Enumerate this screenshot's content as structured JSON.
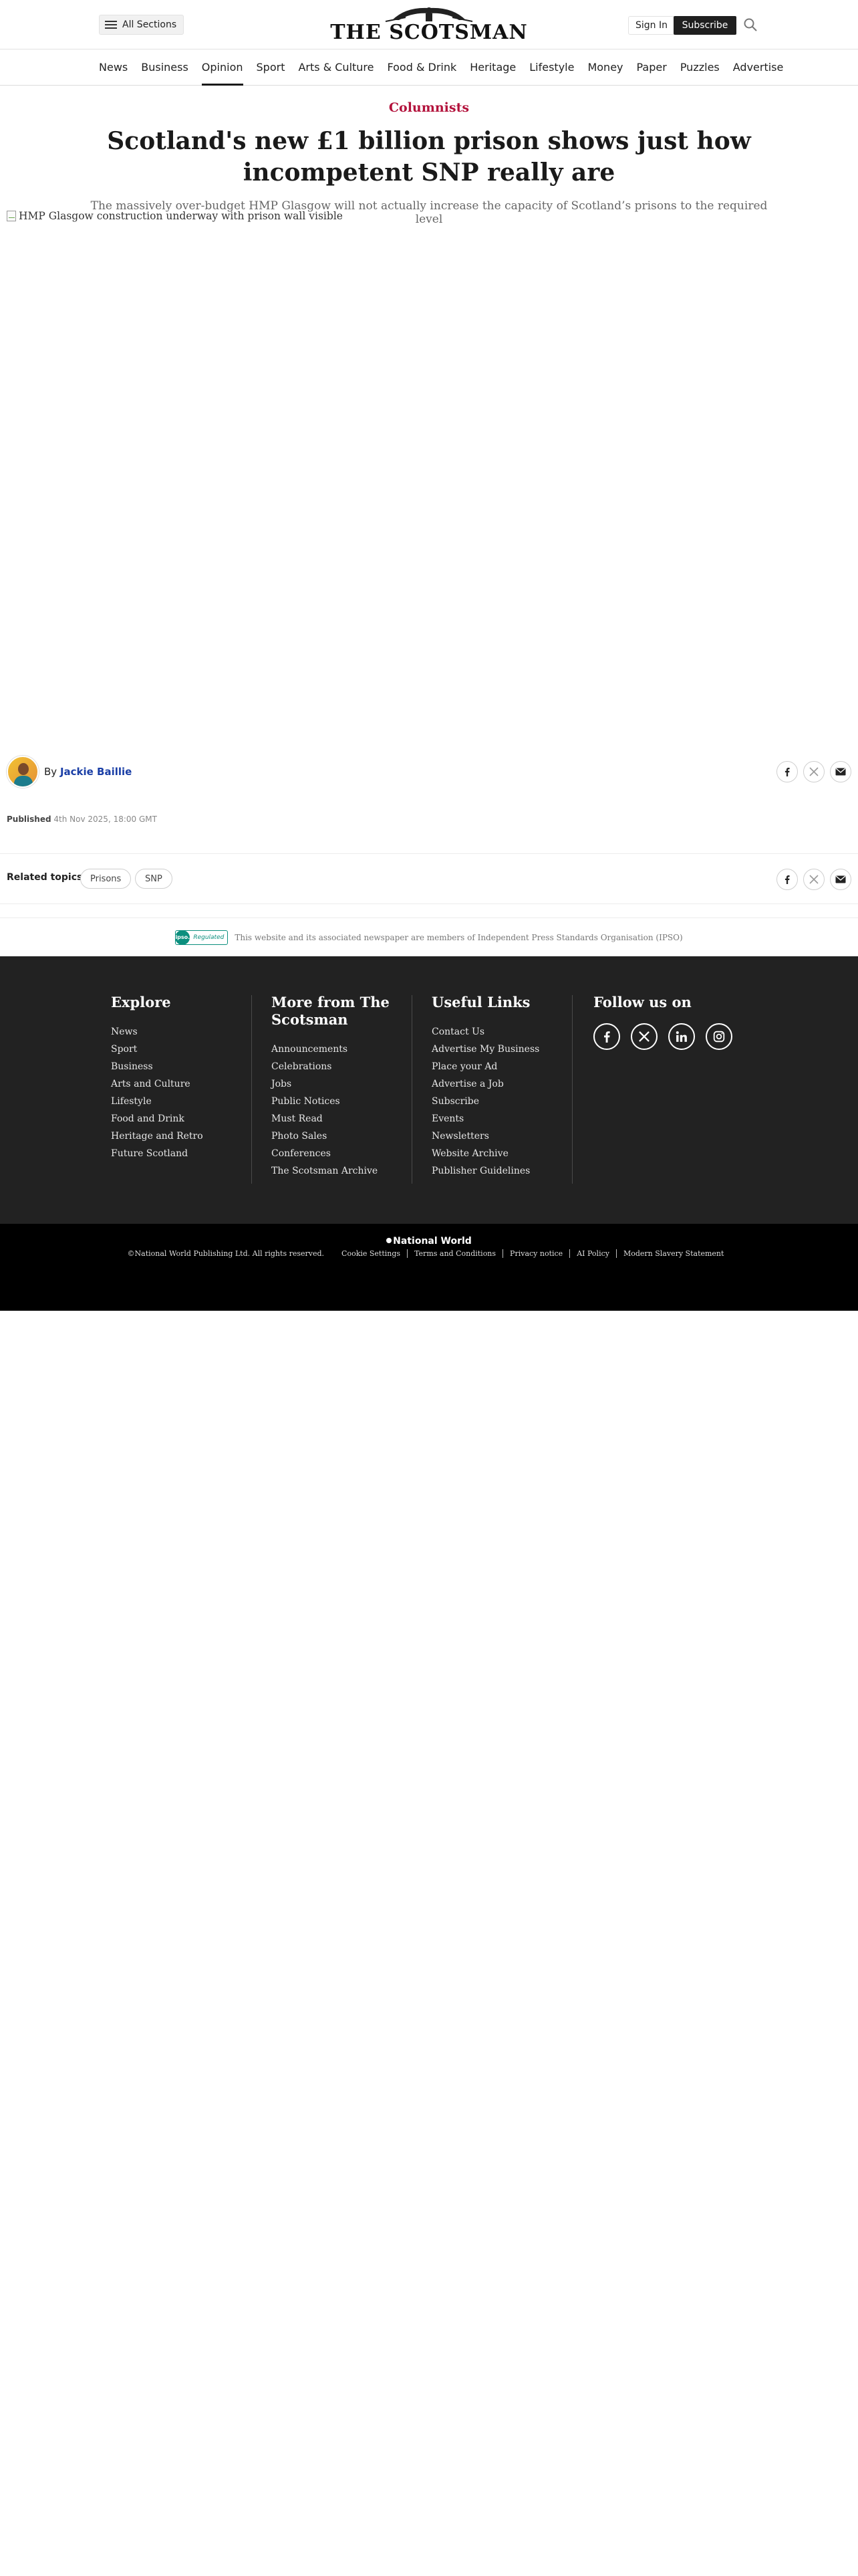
{
  "header": {
    "all_sections_label": "All Sections",
    "site_name": "THE SCOTSMAN",
    "signin_label": "Sign In",
    "subscribe_label": "Subscribe"
  },
  "nav": {
    "items": [
      {
        "label": "News"
      },
      {
        "label": "Business"
      },
      {
        "label": "Opinion",
        "active": true
      },
      {
        "label": "Sport"
      },
      {
        "label": "Arts & Culture"
      },
      {
        "label": "Food & Drink"
      },
      {
        "label": "Heritage"
      },
      {
        "label": "Lifestyle"
      },
      {
        "label": "Money"
      },
      {
        "label": "Paper"
      },
      {
        "label": "Puzzles"
      },
      {
        "label": "Advertise"
      }
    ]
  },
  "article": {
    "category": "Columnists",
    "headline": "Scotland's new £1 billion prison shows just how incompetent SNP really are",
    "standfirst": "The massively over-budget HMP Glasgow will not actually increase the capacity of Scotland’s prisons to the required level",
    "image_alt": "HMP Glasgow construction underway with prison wall visible",
    "byline_prefix": "By",
    "author": "Jackie Baillie",
    "published_label": "Published",
    "published_date": "4th Nov 2025, 18:00 GMT",
    "related_label": "Related topics:",
    "topics": [
      "Prisons",
      "SNP"
    ]
  },
  "ipso": {
    "badge_short": "ipso.",
    "badge_word": "Regulated",
    "text": "This website and its associated newspaper are members of Independent Press Standards Organisation (IPSO)"
  },
  "footer": {
    "explore": {
      "title": "Explore",
      "links": [
        "News",
        "Sport",
        "Business",
        "Arts and Culture",
        "Lifestyle",
        "Food and Drink",
        "Heritage and Retro",
        "Future Scotland"
      ]
    },
    "more": {
      "title": "More from The Scotsman",
      "links": [
        "Announcements",
        "Celebrations",
        "Jobs",
        "Public Notices",
        "Must Read",
        "Photo Sales",
        "Conferences",
        "The Scotsman Archive"
      ]
    },
    "useful": {
      "title": "Useful Links",
      "links": [
        "Contact Us",
        "Advertise My Business",
        "Place your Ad",
        "Advertise a Job",
        "Subscribe",
        "Events",
        "Newsletters",
        "Website Archive",
        "Publisher Guidelines"
      ]
    },
    "follow": {
      "title": "Follow us on",
      "icons": [
        "facebook-icon",
        "x-icon",
        "linkedin-icon",
        "instagram-icon"
      ]
    }
  },
  "bottom": {
    "brand": "National World",
    "copyright": "©National World Publishing Ltd. All rights reserved.",
    "links": [
      "Cookie Settings",
      "Terms and Conditions",
      "Privacy notice",
      "AI Policy",
      "Modern Slavery Statement"
    ]
  },
  "colors": {
    "accent": "#b3123c",
    "footer_bg": "#222222",
    "bottom_bg": "#000000",
    "link": "#1a3ea6"
  }
}
